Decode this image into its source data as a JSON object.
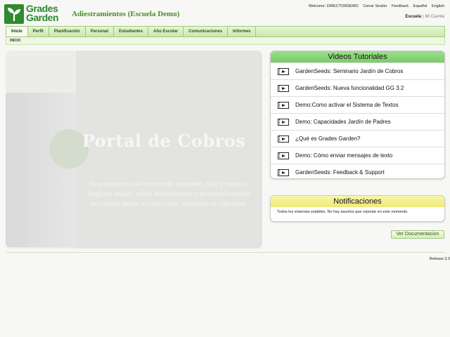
{
  "logo": {
    "line1": "Grades",
    "line2": "Garden",
    "brand_color": "#2e8b2e"
  },
  "school_title": "Adiestramientos (Escuela Demo)",
  "top_links": {
    "welcome": "Welcome: DIRECTORDEMO",
    "logout": "Cerrar Sesión",
    "feedback": "Feedback",
    "spanish": "Español",
    "english": "English"
  },
  "context_links": {
    "school": "Escuela",
    "account": "Mi Cuenta"
  },
  "nav": {
    "items": [
      {
        "label": "Inicio",
        "active": true
      },
      {
        "label": "Perfil",
        "active": false
      },
      {
        "label": "Planificación",
        "active": false
      },
      {
        "label": "Personal",
        "active": false
      },
      {
        "label": "Estudiantes",
        "active": false
      },
      {
        "label": "Año Escolar",
        "active": false
      },
      {
        "label": "Comunicaciones",
        "active": false
      },
      {
        "label": "Informes",
        "active": false
      }
    ]
  },
  "breadcrumb": "INICIO",
  "banner": {
    "title": "Portal de Cobros",
    "description": "El ecosistema de cobro más completo, fácil y seguro. Registra pagos, envía recordatorios y gestiona estados de cuenta desde un solo lugar. Aumenta tu cobranza."
  },
  "videos": {
    "title": "Videos Tutoriales",
    "items": [
      "GardenSeeds: Seminario Jardín de Cobros",
      "GardenSeeds: Nueva funcionalidad GG 3.2",
      "Demo:Como activar el Sistema de Textos",
      "Demo: Capacidades Jardín de Padres",
      "¿Qué es Grades Garden?",
      "Demo: Cómo enviar mensajes de texto",
      "GardenSeeds: Feedback & Support"
    ]
  },
  "notifications": {
    "title": "Notificaciones",
    "message": "Todos los sistemas estables. No hay asuntos que reportar en este momento."
  },
  "doc_button": "Ver Documentacion",
  "release": "Release 3.3",
  "colors": {
    "nav_green": "#cbe8ad",
    "videos_header": "#8fd87f",
    "notif_header": "#f3ef8c"
  }
}
